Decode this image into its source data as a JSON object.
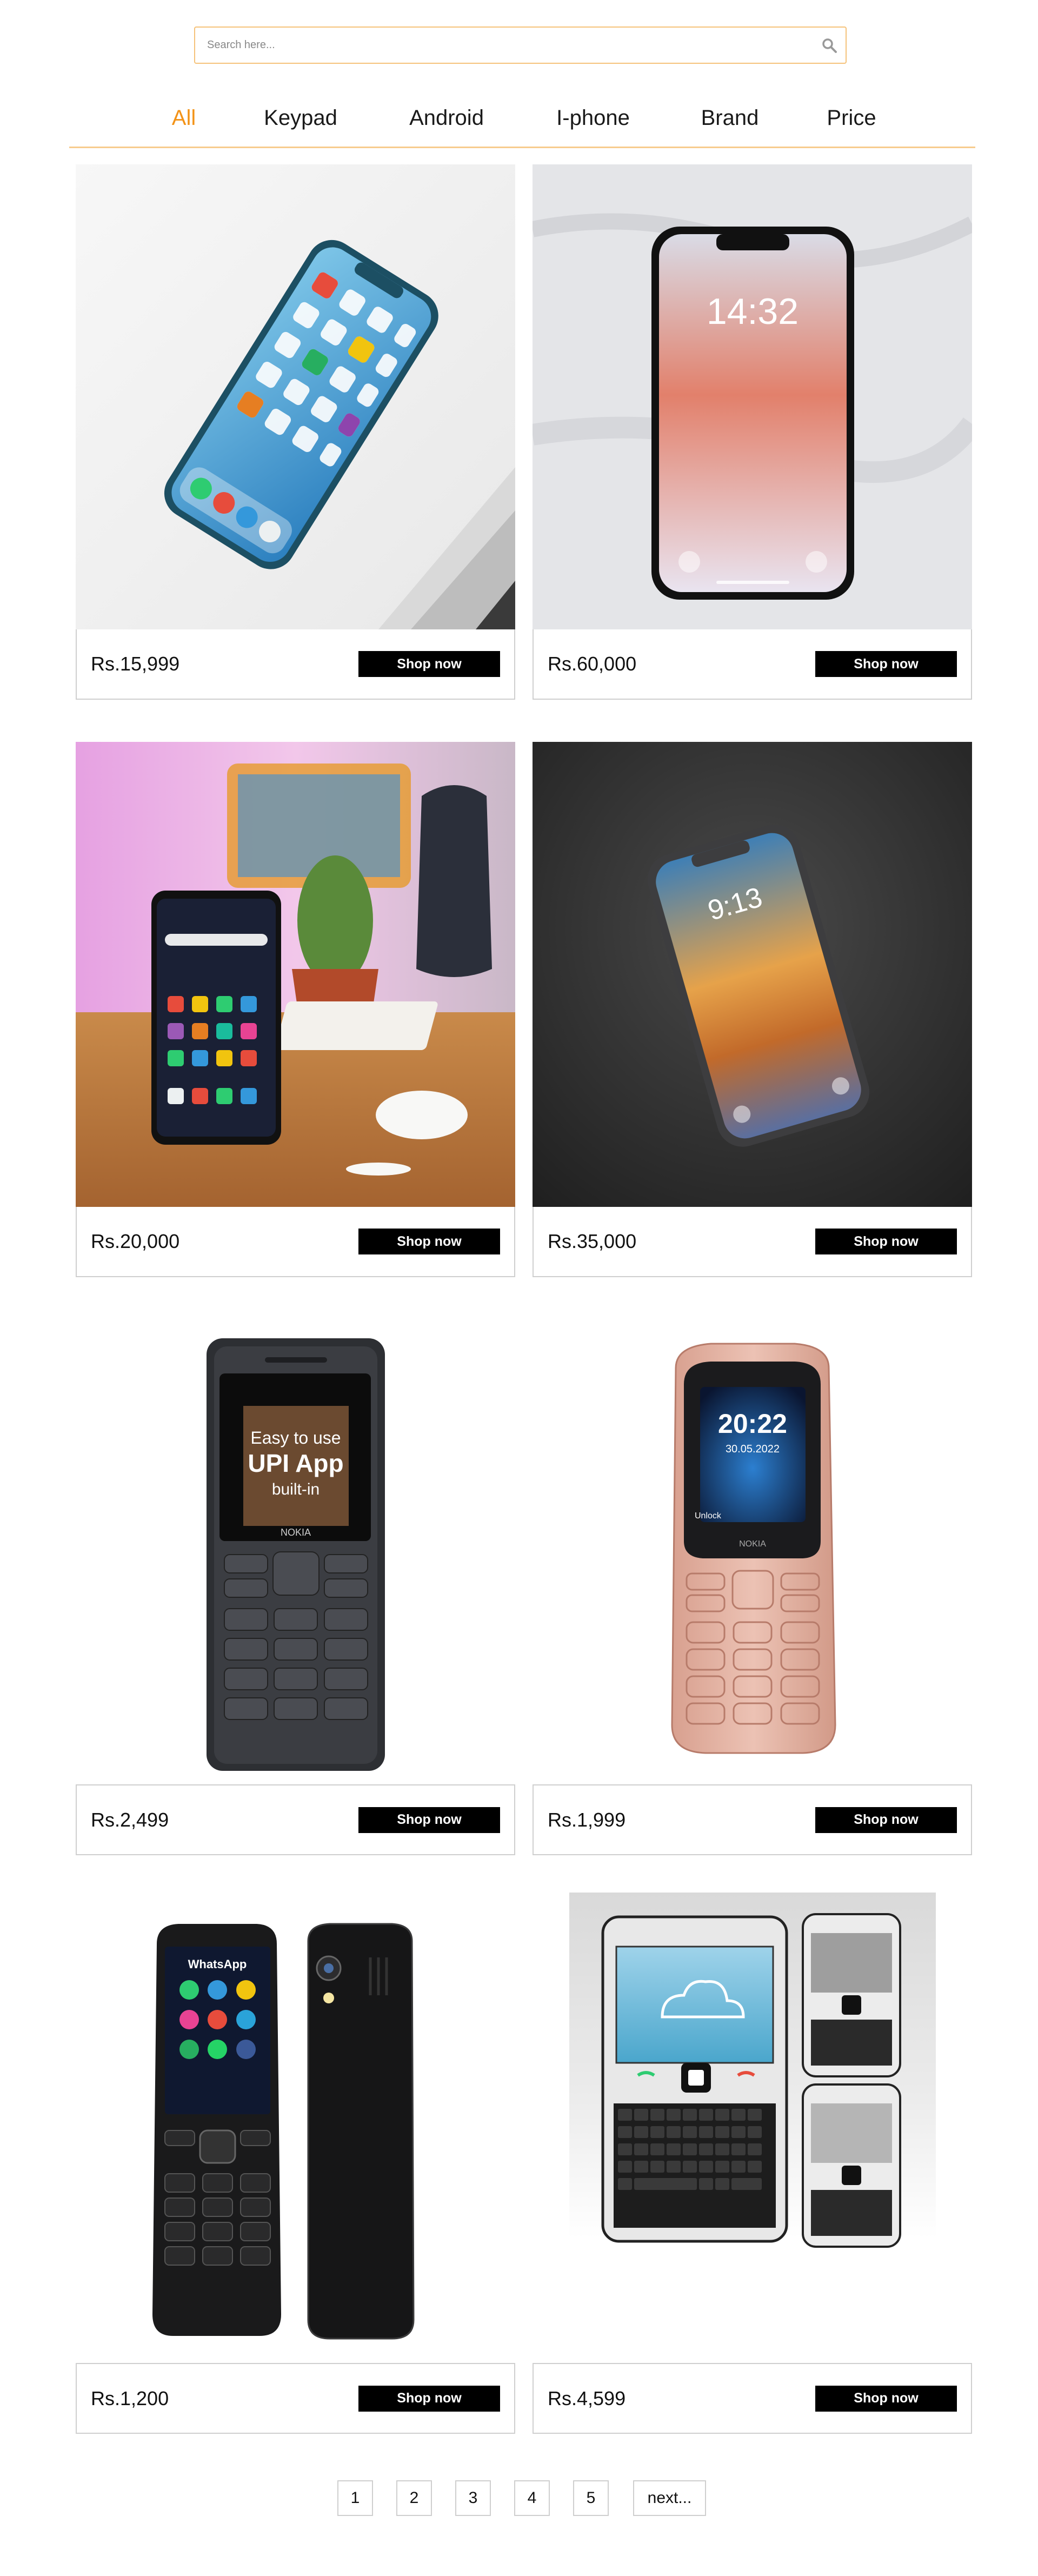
{
  "search": {
    "placeholder": "Search here..."
  },
  "nav": {
    "items": [
      {
        "label": "All",
        "active": true
      },
      {
        "label": "Keypad",
        "active": false
      },
      {
        "label": "Android",
        "active": false
      },
      {
        "label": "I-phone",
        "active": false
      },
      {
        "label": "Brand",
        "active": false
      },
      {
        "label": "Price",
        "active": false
      }
    ]
  },
  "products": [
    {
      "price": "Rs.15,999",
      "button": "Shop now",
      "image": "iphone-on-laptop-photo"
    },
    {
      "price": "Rs.60,000",
      "button": "Shop now",
      "image": "iphone-lockscreen-photo"
    },
    {
      "price": "Rs.20,000",
      "button": "Shop now",
      "image": "android-phone-desk-photo"
    },
    {
      "price": "Rs.35,000",
      "button": "Shop now",
      "image": "iphone-dark-background-photo"
    },
    {
      "price": "Rs.2,499",
      "button": "Shop now",
      "image": "nokia-upi-keypad-phone",
      "screen": {
        "line1": "Easy to use",
        "line2": "UPI App",
        "line3": "built-in"
      },
      "brand": "NOKIA"
    },
    {
      "price": "Rs.1,999",
      "button": "Shop now",
      "image": "nokia-rose-gold-keypad-phone",
      "screen": {
        "time": "20:22",
        "date": "30.05.2022",
        "unlock": "Unlock"
      },
      "brand": "NOKIA"
    },
    {
      "price": "Rs.1,200",
      "button": "Shop now",
      "image": "itel-whatsapp-keypad-phone",
      "screen": {
        "app": "WhatsApp"
      }
    },
    {
      "price": "Rs.4,599",
      "button": "Shop now",
      "image": "qwerty-keyboard-phone"
    }
  ],
  "pagination": {
    "pages": [
      "1",
      "2",
      "3",
      "4",
      "5"
    ],
    "next": "next..."
  },
  "colors": {
    "accent": "#f39318",
    "search_border": "#f5c27a",
    "button_bg": "#000000"
  }
}
